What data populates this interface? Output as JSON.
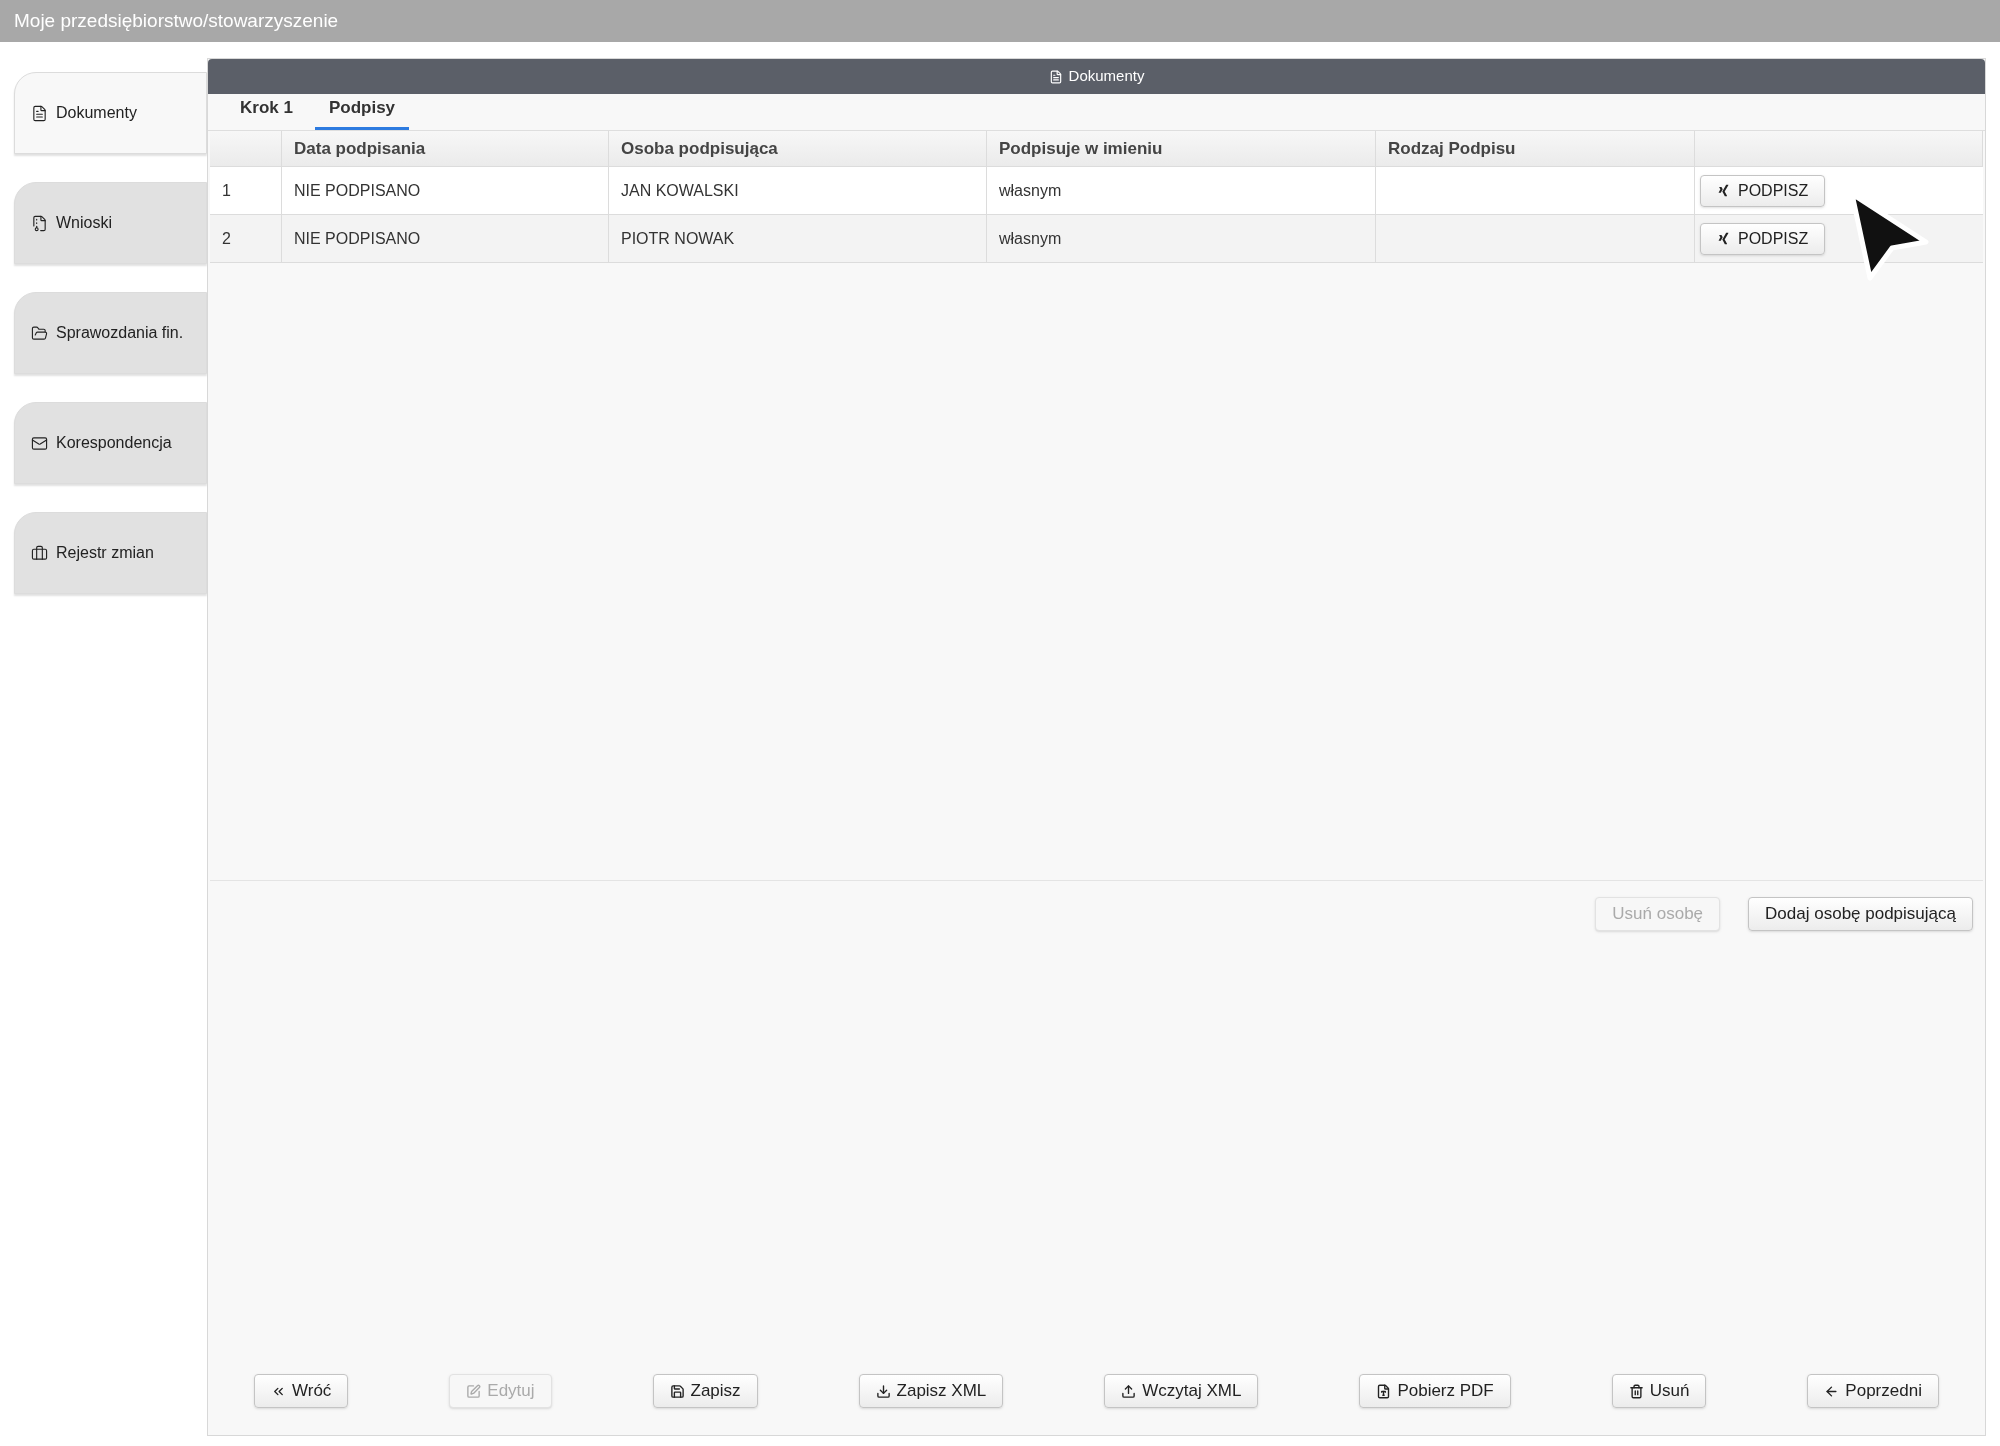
{
  "app_bar": {
    "title": "Moje przedsiębiorstwo/stowarzyszenie"
  },
  "sidebar": {
    "items": [
      {
        "label": "Dokumenty",
        "selected": true
      },
      {
        "label": "Wnioski",
        "selected": false
      },
      {
        "label": "Sprawozdania fin.",
        "selected": false
      },
      {
        "label": "Korespondencja",
        "selected": false
      },
      {
        "label": "Rejestr zmian",
        "selected": false
      }
    ]
  },
  "panel": {
    "title": "Dokumenty",
    "tabs": [
      {
        "label": "Krok 1",
        "selected": false
      },
      {
        "label": "Podpisy",
        "selected": true
      }
    ],
    "table": {
      "columns": [
        "",
        "Data podpisania",
        "Osoba podpisująca",
        "Podpisuje w imieniu",
        "Rodzaj Podpisu",
        ""
      ],
      "rows": [
        {
          "cells": [
            "1",
            "NIE PODPISANO",
            "JAN KOWALSKI",
            "własnym",
            ""
          ],
          "action": "PODPISZ"
        },
        {
          "cells": [
            "2",
            "NIE PODPISANO",
            "PIOTR NOWAK",
            "własnym",
            ""
          ],
          "action": "PODPISZ"
        }
      ]
    },
    "table_buttons": [
      {
        "label": "Usuń osobę",
        "disabled": true
      },
      {
        "label": "Dodaj osobę podpisującą",
        "disabled": false
      }
    ],
    "footer_buttons": [
      {
        "label": "Wróć",
        "disabled": false
      },
      {
        "label": "Edytuj",
        "disabled": true
      },
      {
        "label": "Zapisz",
        "disabled": false
      },
      {
        "label": "Zapisz XML",
        "disabled": false
      },
      {
        "label": "Wczytaj XML",
        "disabled": false
      },
      {
        "label": "Pobierz PDF",
        "disabled": false
      },
      {
        "label": "Usuń",
        "disabled": false
      },
      {
        "label": "Poprzedni",
        "disabled": false
      }
    ]
  }
}
